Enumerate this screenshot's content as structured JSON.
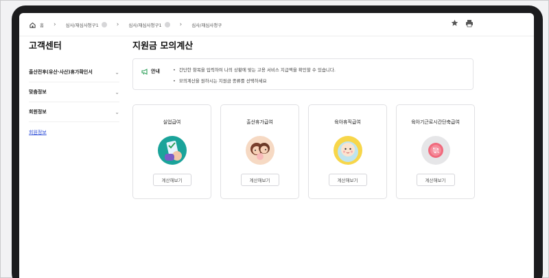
{
  "breadcrumb": {
    "home_label": "홈",
    "items": [
      "심사/재심사청구1",
      "심사/재심사청구1",
      "심사/재심사청구"
    ]
  },
  "sidebar": {
    "title": "고객센터",
    "items": [
      {
        "label": "출산전후(유산·사산)휴가확인서",
        "expandable": true
      },
      {
        "label": "맞춤정보",
        "expandable": true
      },
      {
        "label": "회원정보",
        "expandable": true
      },
      {
        "label": "회원정보",
        "expandable": false,
        "active_link": true
      }
    ]
  },
  "main": {
    "title": "지원금 모의계산",
    "notice": {
      "label": "안내",
      "lines": [
        "간단한 항목을 입력하여 나의 상황에 맞는 고용 서비스 지급액을 확인할 수 있습니다.",
        "모의계산을 원하시는 지원금 종류를 선택하세요"
      ]
    },
    "cards": [
      {
        "title": "실업급여",
        "button": "계산해보기",
        "icon": "unemployment-icon",
        "bg": "#1aa39a"
      },
      {
        "title": "출산휴가급여",
        "button": "계산해보기",
        "icon": "maternity-icon",
        "bg": "#f6d9c3"
      },
      {
        "title": "육아휴직급여",
        "button": "계산해보기",
        "icon": "baby-icon",
        "bg": "#f7d64a"
      },
      {
        "title": "육아기근로시간단축급여",
        "button": "계산해보기",
        "icon": "flower-icon",
        "bg": "#e6e6e8"
      }
    ]
  },
  "colors": {
    "accent_link": "#2a4bd7",
    "notice_icon": "#2fa05b",
    "device_frame": "#1c1c1e"
  }
}
